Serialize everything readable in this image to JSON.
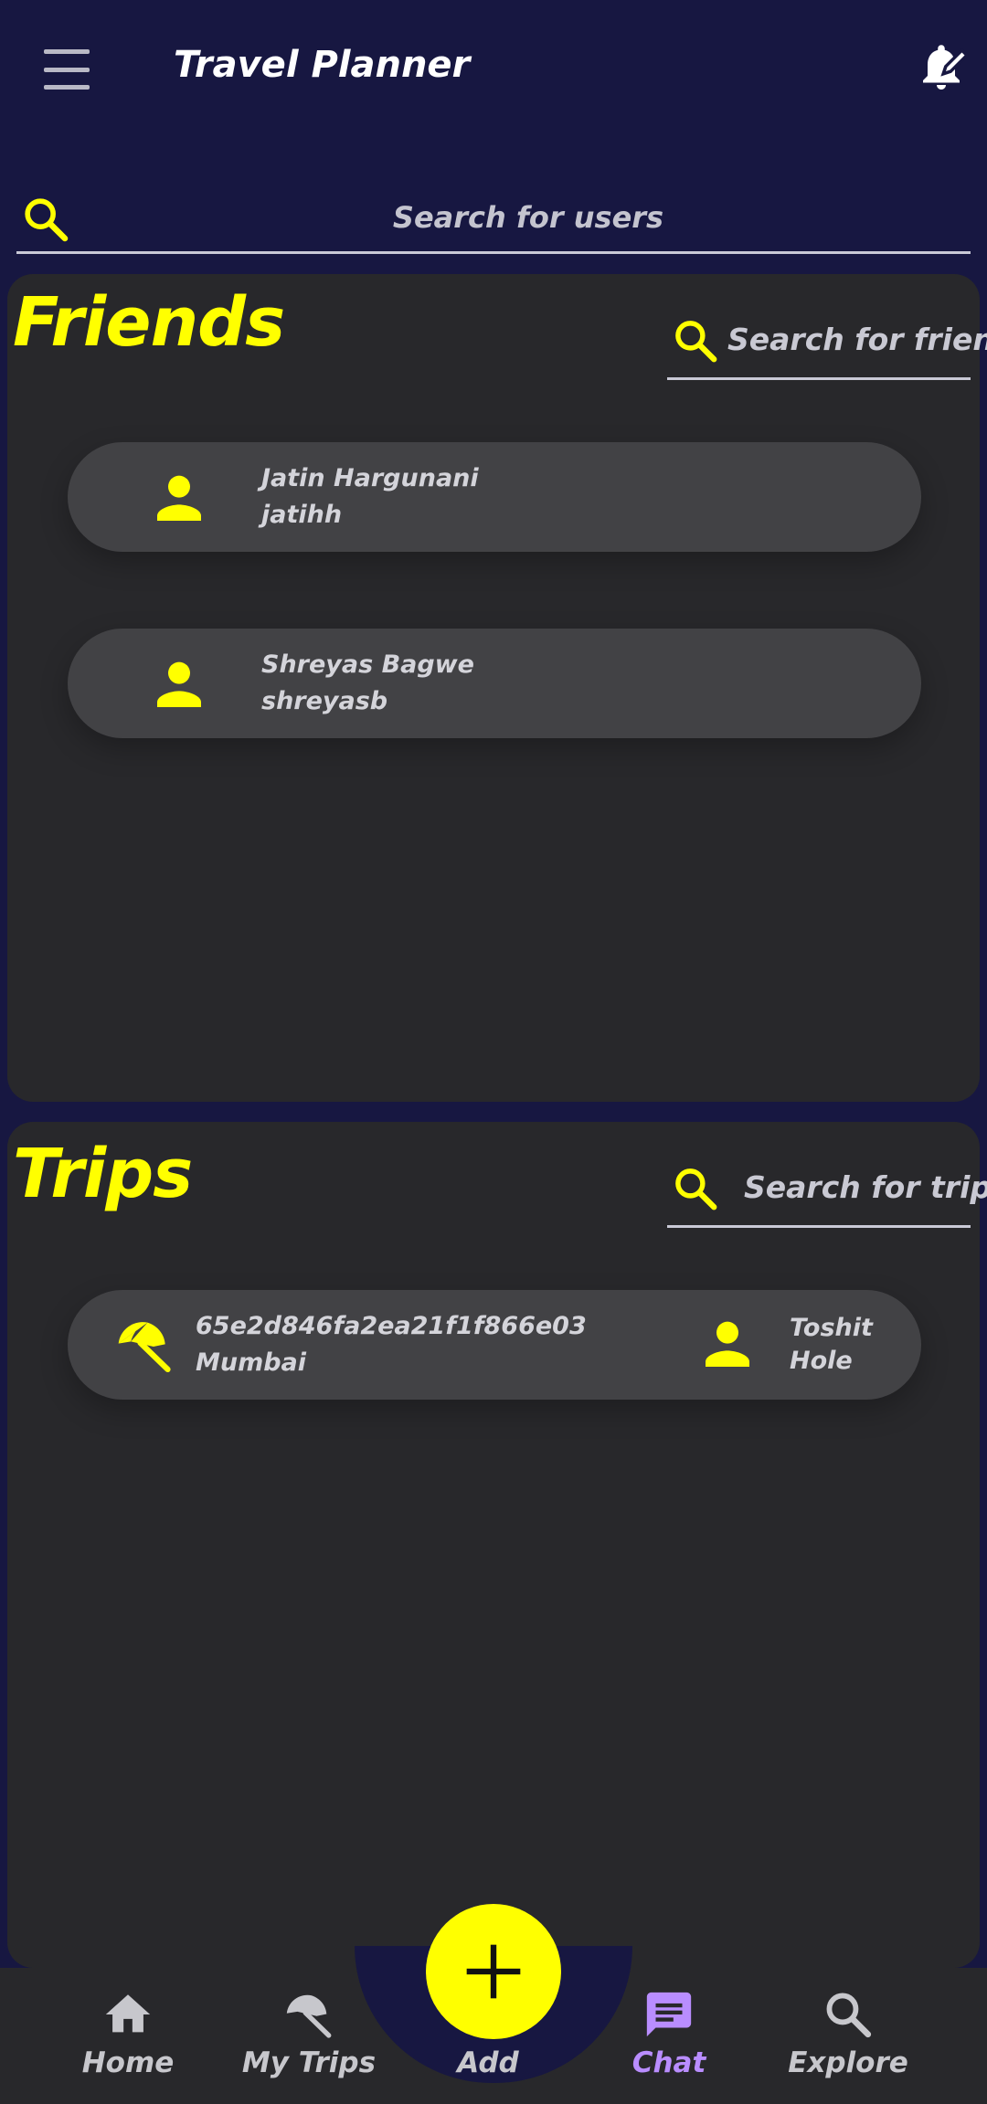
{
  "app": {
    "title": "Travel Planner"
  },
  "user_search": {
    "placeholder": "Search for users"
  },
  "friends": {
    "title": "Friends",
    "search_placeholder": "Search for friends",
    "items": [
      {
        "name": "Jatin Hargunani",
        "username": "jatihh"
      },
      {
        "name": "Shreyas Bagwe",
        "username": "shreyasb"
      }
    ]
  },
  "trips": {
    "title": "Trips",
    "search_placeholder": "Search for trips",
    "items": [
      {
        "id": "65e2d846fa2ea21f1f866e03",
        "destination": "Mumbai",
        "owner_first": "Toshit",
        "owner_last": "Hole"
      }
    ]
  },
  "bottom_nav": {
    "items": [
      {
        "label": "Home",
        "icon": "home-icon"
      },
      {
        "label": "My Trips",
        "icon": "umbrella-icon"
      },
      {
        "label": "Add",
        "icon": "plus-icon"
      },
      {
        "label": "Chat",
        "icon": "chat-icon"
      },
      {
        "label": "Explore",
        "icon": "search-icon"
      }
    ],
    "active": "Chat"
  },
  "colors": {
    "background": "#171741",
    "panel": "#28282b",
    "card": "#424245",
    "accent": "#ffff00",
    "active_nav": "#b98dff"
  }
}
